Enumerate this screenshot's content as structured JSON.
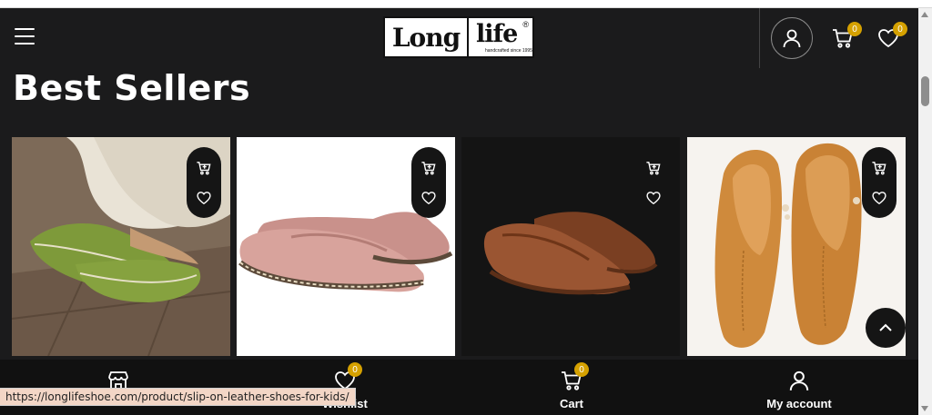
{
  "header": {
    "logo": {
      "word1": "Long",
      "word2": "life",
      "registered": "®",
      "tagline": "handcrafted since 1995"
    },
    "cart_count": "0",
    "wishlist_count": "0"
  },
  "section": {
    "title": "Best Sellers"
  },
  "products": [
    {
      "name": "green-leather-slipper",
      "colors": {
        "shoe": "#7e9a3a",
        "accent": "#5d7428"
      }
    },
    {
      "name": "pink-leather-slip-on",
      "colors": {
        "shoe": "#d8a39c",
        "accent": "#b8847d"
      }
    },
    {
      "name": "brown-suede-slip-on",
      "colors": {
        "shoe": "#9a5532",
        "accent": "#7a3f22"
      }
    },
    {
      "name": "tan-leather-flat",
      "colors": {
        "shoe": "#cf8a3c",
        "accent": "#a86a25"
      }
    }
  ],
  "bottom_nav": {
    "wishlist_label": "Wishlist",
    "wishlist_count": "0",
    "cart_label": "Cart",
    "cart_count": "0",
    "account_label": "My account"
  },
  "status_url": "https://longlifeshoe.com/product/slip-on-leather-shoes-for-kids/",
  "colors": {
    "page_bg": "#1b1b1c",
    "badge": "#d5a100",
    "bottom_bar": "#111111"
  }
}
